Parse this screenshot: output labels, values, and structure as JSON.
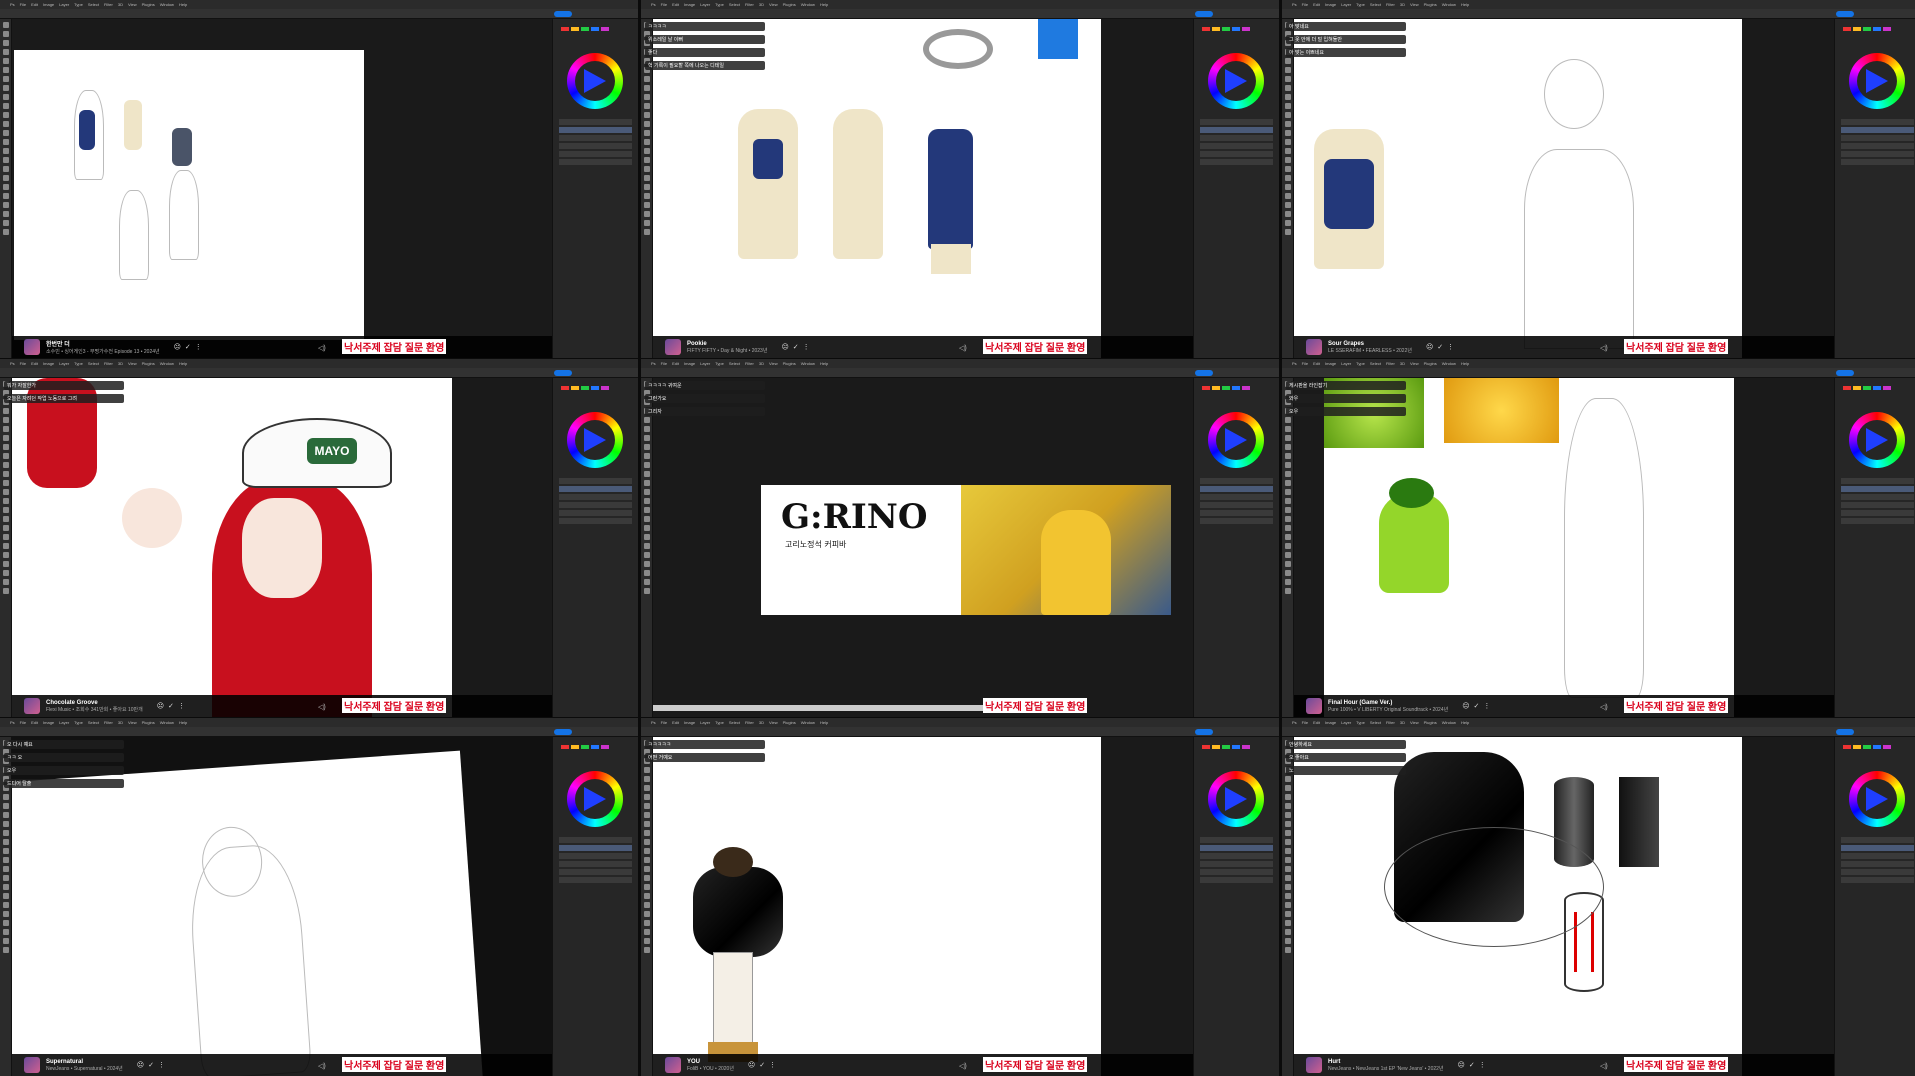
{
  "app": {
    "menu_items": [
      "Ps",
      "File",
      "Edit",
      "Image",
      "Layer",
      "Type",
      "Select",
      "Filter",
      "3D",
      "View",
      "Plugins",
      "Window",
      "Help"
    ]
  },
  "caption": "낙서주제 잡담 질문 환영",
  "colors": {
    "accent": "#1473e6",
    "caption_red": "#d9001b",
    "panel_bg": "#262626"
  },
  "cells": [
    {
      "id": 1,
      "media": {
        "title": "한번만 더",
        "subtitle": "소수빈 • 싱어게인3 - 무명가수전 Episode 13 • 2024년"
      },
      "chat": []
    },
    {
      "id": 2,
      "media": {
        "title": "Pookie",
        "subtitle": "FIFTY FIFTY • Day & Night • 2023년"
      },
      "chat": [
        "ㅋㅋㅋㅋ",
        "위소레일 날 이뻐",
        "좋다",
        "헉 기록이 필요할 쪽에 나오는 디테일"
      ]
    },
    {
      "id": 3,
      "media": {
        "title": "Sour Grapes",
        "subtitle": "LE SSERAFIM • FEARLESS • 2022년"
      },
      "chat": [
        "아 맞네요",
        "그 옷 안에 더 덜 입혀둘만",
        "아 맞는 이쁘네요"
      ]
    },
    {
      "id": 4,
      "media": {
        "title": "Chocolate Groove",
        "subtitle": "Flexi Music • 조회수 341만회 • 좋아요 10만개"
      },
      "chat": [
        "뭐가 자잘한가",
        "오늘은 자려던 작업 노동으로 그려"
      ],
      "label": "MAYO"
    },
    {
      "id": 5,
      "media": {
        "title": "",
        "subtitle": ""
      },
      "chat": [
        "ㅋㅋㅋㅋ 귀여운",
        "그런가요",
        "그리자"
      ],
      "logo": "G:RINO",
      "logo_sub": "고리노정석 커피바"
    },
    {
      "id": 6,
      "media": {
        "title": "Final Hour (Game Ver.)",
        "subtitle": "Pure 100% • V LIBERTY Original Soundtrack • 2024년"
      },
      "chat": [
        "게시판을 라인잡기",
        "와우",
        "오우"
      ]
    },
    {
      "id": 7,
      "media": {
        "title": "Supernatural",
        "subtitle": "NewJeans • Supernatural • 2024년"
      },
      "chat": [
        "오 다시 예요",
        "ㅋㅋ 오",
        "오우",
        "드디어 탈출"
      ]
    },
    {
      "id": 8,
      "media": {
        "title": "YOU",
        "subtitle": "FoliB • YOU • 2020년"
      },
      "chat": [
        "ㅋㅋㅋㅋㅋ",
        "어떤 거예요"
      ]
    },
    {
      "id": 9,
      "media": {
        "title": "Hurt",
        "subtitle": "NewJeans • NewJeans 1st EP 'New Jeans' • 2022년"
      },
      "chat": [
        "안녕하세요",
        "오 좋아요",
        "노"
      ]
    }
  ]
}
